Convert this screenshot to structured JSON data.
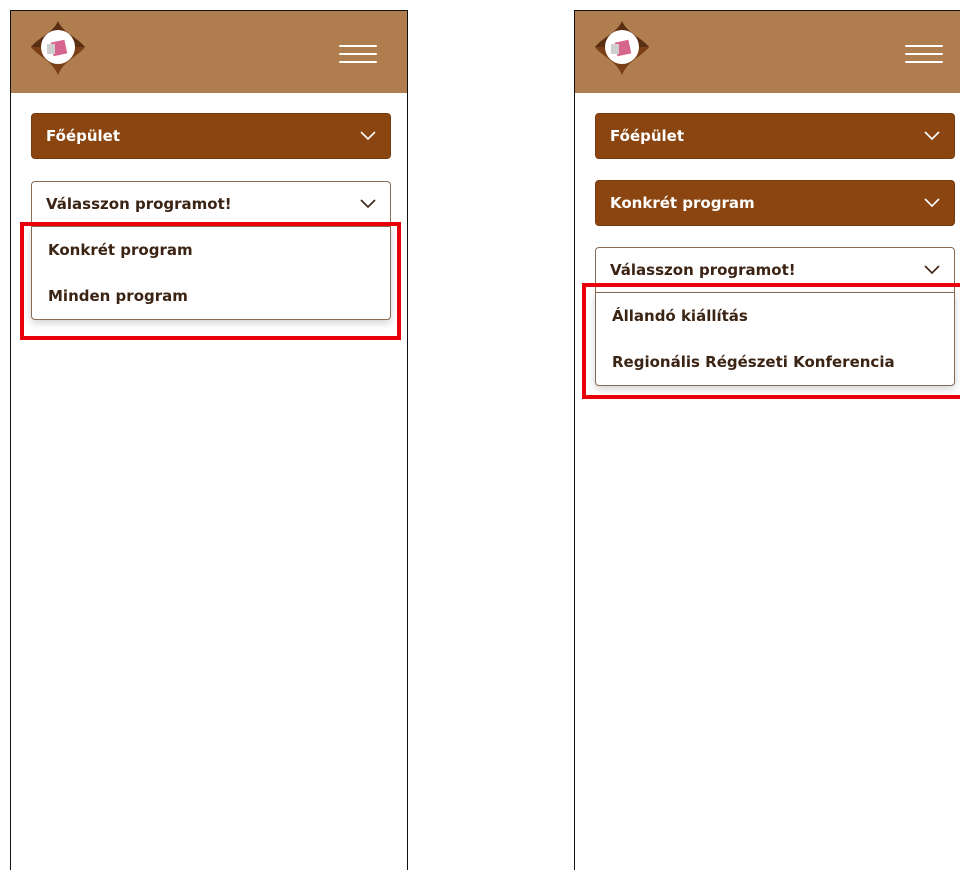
{
  "colors": {
    "header_bg": "#b07d4f",
    "select_filled_bg": "#8a4510",
    "text_dark": "#3b2414",
    "highlight": "#e8000b"
  },
  "left_screen": {
    "location_select": {
      "value": "Főépület",
      "icon": "chevron-down-icon"
    },
    "program_select": {
      "placeholder": "Válasszon programot!",
      "icon": "chevron-down-icon",
      "options": [
        "Konkrét program",
        "Minden program"
      ]
    }
  },
  "right_screen": {
    "location_select": {
      "value": "Főépület",
      "icon": "chevron-down-icon"
    },
    "program_type_select": {
      "value": "Konkrét program",
      "icon": "chevron-down-icon"
    },
    "program_select": {
      "placeholder": "Válasszon programot!",
      "icon": "chevron-down-icon",
      "options": [
        "Állandó kiállítás",
        "Regionális Régészeti Konferencia"
      ]
    }
  }
}
